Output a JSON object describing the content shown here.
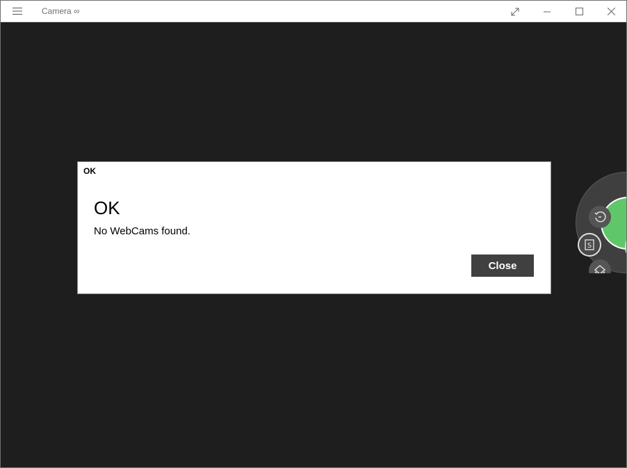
{
  "window": {
    "title": "Camera ∞"
  },
  "titlebar": {
    "menu_icon": "hamburger-icon",
    "fullscreen_icon": "expand-diagonal-icon",
    "minimize_icon": "minimize-icon",
    "maximize_icon": "maximize-icon",
    "close_icon": "close-icon"
  },
  "dialog": {
    "caption": "OK",
    "heading": "OK",
    "message": "No WebCams found.",
    "close_label": "Close"
  },
  "controls": {
    "shutter_color": "#5fc76a",
    "timer_icon": "timer-icon",
    "mode_icon": "photo-mode-icon",
    "layers_icon": "layers-icon"
  },
  "colors": {
    "background": "#1e1e1e",
    "titlebar": "#ffffff",
    "button": "#404040"
  }
}
